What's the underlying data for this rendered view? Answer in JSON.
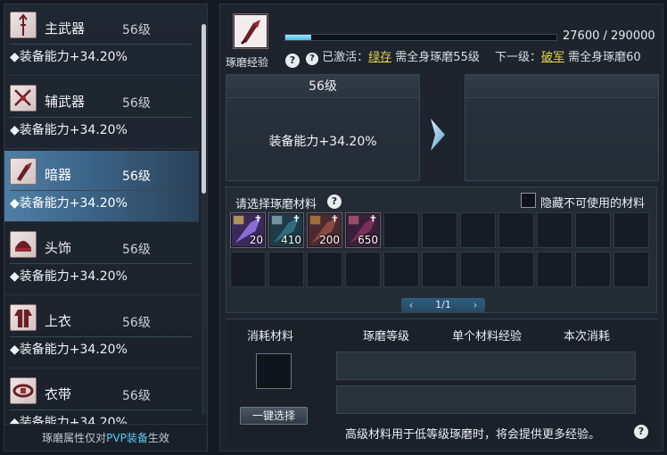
{
  "equipment_list": [
    {
      "name": "主武器",
      "level": "56级",
      "stat": "◆装备能力+34.20%",
      "icon": "spear-icon",
      "active": false
    },
    {
      "name": "辅武器",
      "level": "56级",
      "stat": "◆装备能力+34.20%",
      "icon": "crossed-swords-icon",
      "active": false
    },
    {
      "name": "暗器",
      "level": "56级",
      "stat": "◆装备能力+34.20%",
      "icon": "hidden-weapon-icon",
      "active": true
    },
    {
      "name": "头饰",
      "level": "56级",
      "stat": "◆装备能力+34.20%",
      "icon": "headgear-icon",
      "active": false
    },
    {
      "name": "上衣",
      "level": "56级",
      "stat": "◆装备能力+34.20%",
      "icon": "robe-icon",
      "active": false
    },
    {
      "name": "衣带",
      "level": "56级",
      "stat": "◆装备能力+34.20%",
      "icon": "belt-icon",
      "active": false
    }
  ],
  "left_footer": {
    "prefix": "琢磨属性仅对",
    "highlight": "PVP装备",
    "suffix": "生效"
  },
  "experience": {
    "label": "琢磨经验",
    "help": "?",
    "current": 27600,
    "max": 290000,
    "value_text": "27600 / 290000",
    "activated_prefix": "已激活：",
    "activated_name": "绿存",
    "activated_suffix": " 需全身琢磨55级",
    "next_prefix": "下一级：",
    "next_name": "破军",
    "next_suffix": " 需全身琢磨60"
  },
  "current_level": {
    "header": "56级",
    "stat": "装备能力+34.20%"
  },
  "next_level": {
    "header": "",
    "stat": ""
  },
  "materials": {
    "title": "请选择琢磨材料",
    "help": "?",
    "hide_unusable_label": "隐藏不可使用的材料",
    "hide_unusable_checked": false,
    "items": [
      {
        "qty": "20",
        "icon": "material-icon-1"
      },
      {
        "qty": "410",
        "icon": "material-icon-2"
      },
      {
        "qty": "200",
        "icon": "material-icon-3"
      },
      {
        "qty": "650",
        "icon": "material-icon-4"
      }
    ],
    "page_text": "1/1"
  },
  "consume": {
    "headers": [
      "消耗材料",
      "琢磨等级",
      "单个材料经验",
      "本次消耗"
    ],
    "select_button": "一键选择",
    "hint": "高级材料用于低等级琢磨时，将会提供更多经验。",
    "help": "?"
  },
  "colors": {
    "accent": "#5fc8f0",
    "highlight_yellow": "#e7d24a",
    "active_row": "#4f7fa6"
  }
}
